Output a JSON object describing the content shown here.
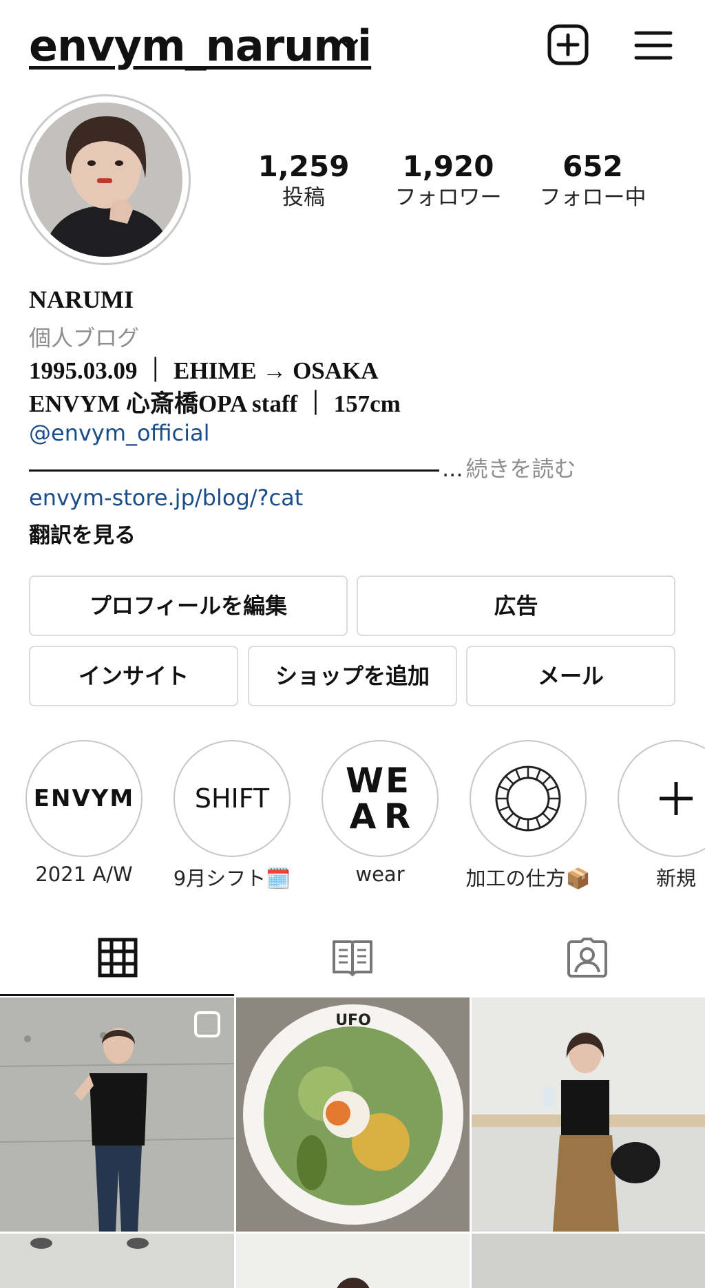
{
  "header": {
    "username": "envym_narumi"
  },
  "stats": [
    {
      "value": "1,259",
      "label": "投稿"
    },
    {
      "value": "1,920",
      "label": "フォロワー"
    },
    {
      "value": "652",
      "label": "フォロー中"
    }
  ],
  "bio": {
    "name": "NARUMI",
    "category": "個人ブログ",
    "line1": "1995.03.09 ｜ EHIME → OSAKA",
    "line2": "ENVYM 心斎橋OPA staff ｜ 157cm",
    "mention": "@envym_official",
    "ellipsis": "...",
    "read_more": "続きを読む",
    "link": "envym-store.jp/blog/?cat",
    "translate": "翻訳を見る"
  },
  "buttons": {
    "edit_profile": "プロフィールを編集",
    "ads": "広告",
    "insights": "インサイト",
    "add_shop": "ショップを追加",
    "email": "メール"
  },
  "highlights": [
    {
      "cover_text": "ENVYM",
      "label": "2021 A/W"
    },
    {
      "cover_text": "SHIFT",
      "label": "9月シフト🗓️"
    },
    {
      "cover_text": [
        "W",
        "E",
        "A",
        "R"
      ],
      "label": "wear"
    },
    {
      "cover_text": "",
      "label": "加工の仕方📦"
    },
    {
      "cover_text": "",
      "label": "新規"
    }
  ],
  "tabs": [
    "grid-icon",
    "guide-icon",
    "tagged-icon"
  ],
  "colors": {
    "link": "#1b4d89",
    "muted": "#8e8e8e",
    "border": "#dbdbdb",
    "text": "#262626"
  }
}
